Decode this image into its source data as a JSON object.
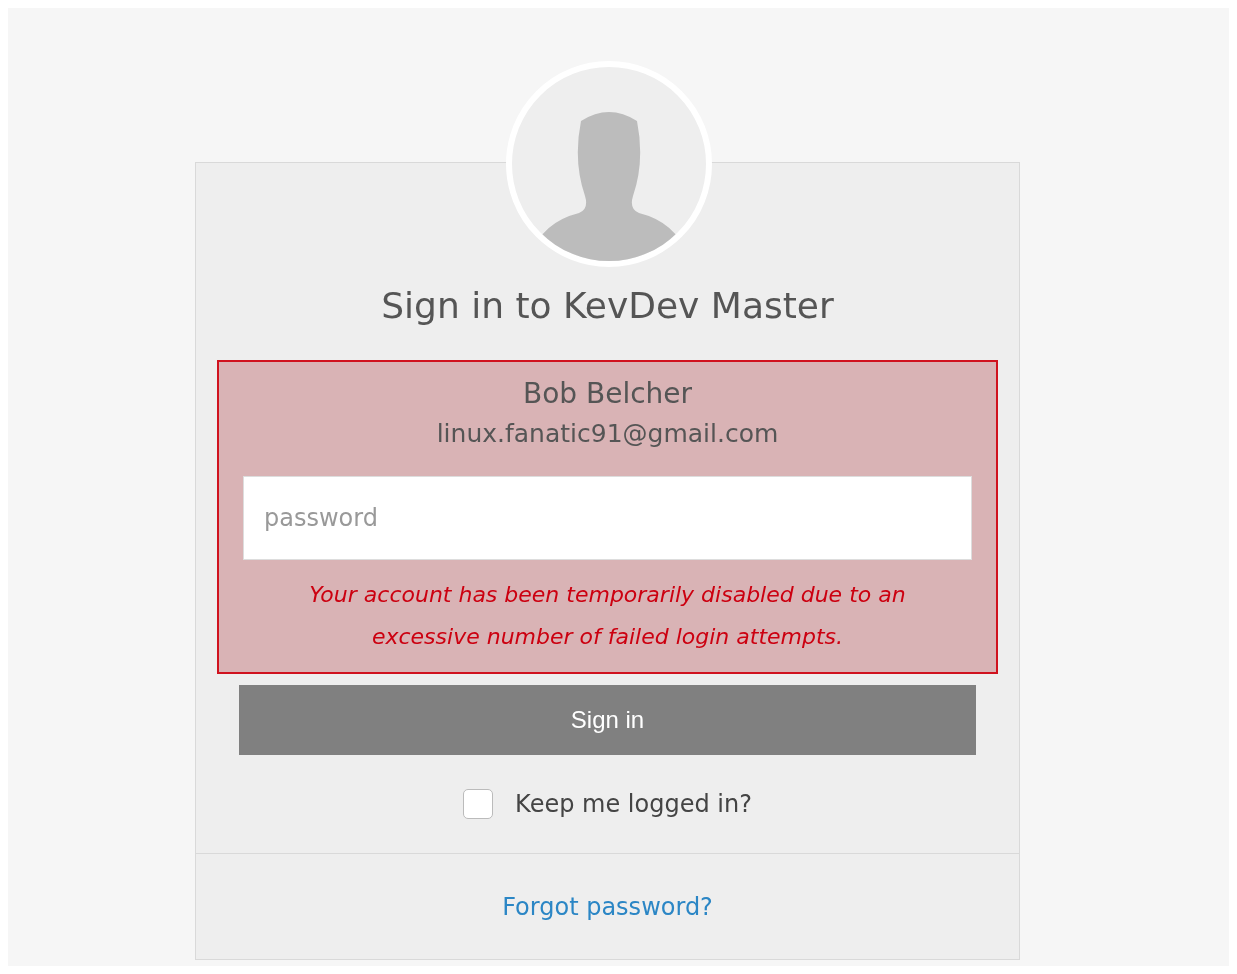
{
  "title": "Sign in to KevDev Master",
  "account": {
    "name": "Bob Belcher",
    "email": "linux.fanatic91@gmail.com"
  },
  "password": {
    "placeholder": "password"
  },
  "error": "Your account has been temporarily disabled due to an excessive number of failed login attempts.",
  "sign_in_button": "Sign in",
  "keep_logged_in": {
    "label": "Keep me logged in?",
    "checked": false
  },
  "forgot_link": "Forgot password?"
}
